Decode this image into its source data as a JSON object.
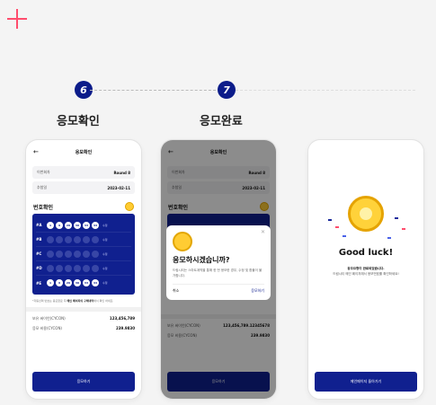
{
  "steps": [
    {
      "num": "6",
      "title": "응모확인"
    },
    {
      "num": "7",
      "title": "응모완료"
    }
  ],
  "screen_confirm": {
    "header": "응모확인",
    "rows": [
      {
        "label": "이번회차",
        "value": "Round 8"
      },
      {
        "label": "추첨일",
        "value": "2023-02-11"
      }
    ],
    "section": "번호확인",
    "lines": [
      {
        "tag": "#A",
        "balls": [
          "1",
          "9",
          "20",
          "30",
          "33",
          "44"
        ],
        "edit": "수정"
      },
      {
        "tag": "#B",
        "balls": [],
        "edit": "수정"
      },
      {
        "tag": "#C",
        "balls": [],
        "edit": "수정"
      },
      {
        "tag": "#D",
        "balls": [],
        "edit": "수정"
      },
      {
        "tag": "#E",
        "balls": [
          "1",
          "9",
          "20",
          "30",
          "33",
          "44"
        ],
        "edit": "수정"
      }
    ],
    "note_prefix": "*자동선택 번호는 응모완료 후 ",
    "note_bold": "메인 페이지의 구매내역",
    "note_suffix": "에서 확인 하세요.",
    "values": [
      {
        "label": "보유 싸이언(CYCON)",
        "value": "123,456,789"
      },
      {
        "label": "응모 비용(CYCON)",
        "value": "239.9830"
      }
    ],
    "cta": "응모하기"
  },
  "screen_modal": {
    "header": "응모확인",
    "rows": [
      {
        "label": "이번회차",
        "value": "Round 8"
      },
      {
        "label": "추첨일",
        "value": "2023-02-11"
      }
    ],
    "section": "번호확인",
    "modal_title": "응모하시겠습니까?",
    "modal_text": "드림시티는 스마트계약을 통해 한 번 응모한 경우, 수정 및 환불이 불가합니다.",
    "cancel": "취소",
    "confirm": "응모하기",
    "values": [
      {
        "label": "보유 싸이언(CYCON)",
        "value": "123,456,789.12345678"
      },
      {
        "label": "응모 비용(CYCON)",
        "value": "239.9830"
      }
    ],
    "cta": "응모하기"
  },
  "screen_done": {
    "title": "Good luck!",
    "sub_bold": "응모요청이 완료되었습니다.",
    "sub": "드림시티 메인 페이지에서 응모번호를 확인하세요!",
    "cta": "메인페이지 돌아가기"
  },
  "colors": {
    "brand": "#10208f",
    "accent": "#ff4d6d",
    "coin": "#ffcc33"
  }
}
